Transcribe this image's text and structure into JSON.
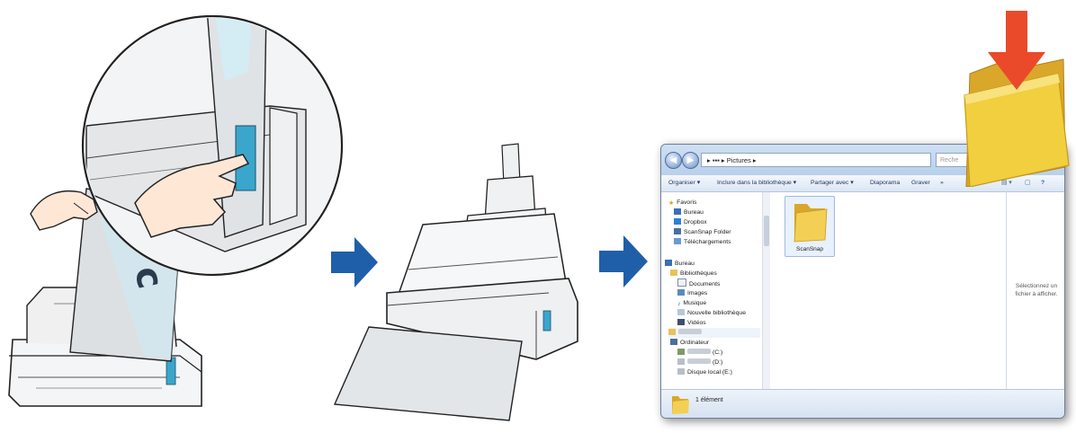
{
  "steps": [
    "insert-document-and-press-scan",
    "scanner-feeds-document",
    "folder-receives-image"
  ],
  "scanner_sheet": {
    "printed_mark": "c"
  },
  "explorer": {
    "address": "▸ ▪▪▪ ▸ Pictures ▸",
    "search_placeholder": "Reche",
    "toolbar": [
      "Organiser ▾",
      "Inclure dans la bibliothèque ▾",
      "Partager avec ▾",
      "Diaporama",
      "Graver",
      "»"
    ],
    "nav": {
      "favorites_header": "Favoris",
      "favorites": [
        "Bureau",
        "Dropbox",
        "ScanSnap Folder",
        "Téléchargements"
      ],
      "desktop_header": "Bureau",
      "libraries_header": "Bibliothèques",
      "libraries": [
        "Documents",
        "Images",
        "Musique",
        "Nouvelle bibliothèque",
        "Vidéos"
      ],
      "computer_header": "Ordinateur",
      "drives": [
        "(C:)",
        "(D:)",
        "Disque local (E:)"
      ]
    },
    "content": {
      "folder_name": "ScanSnap"
    },
    "preview_text": "Sélectionnez un fichier à afficher.",
    "status_text": "1 élément"
  },
  "colors": {
    "step_arrow": "#1f5faa",
    "folder_yellow": "#f1cf3f",
    "download_arrow": "#ea4a2a",
    "button_accent": "#3aa6cc"
  }
}
